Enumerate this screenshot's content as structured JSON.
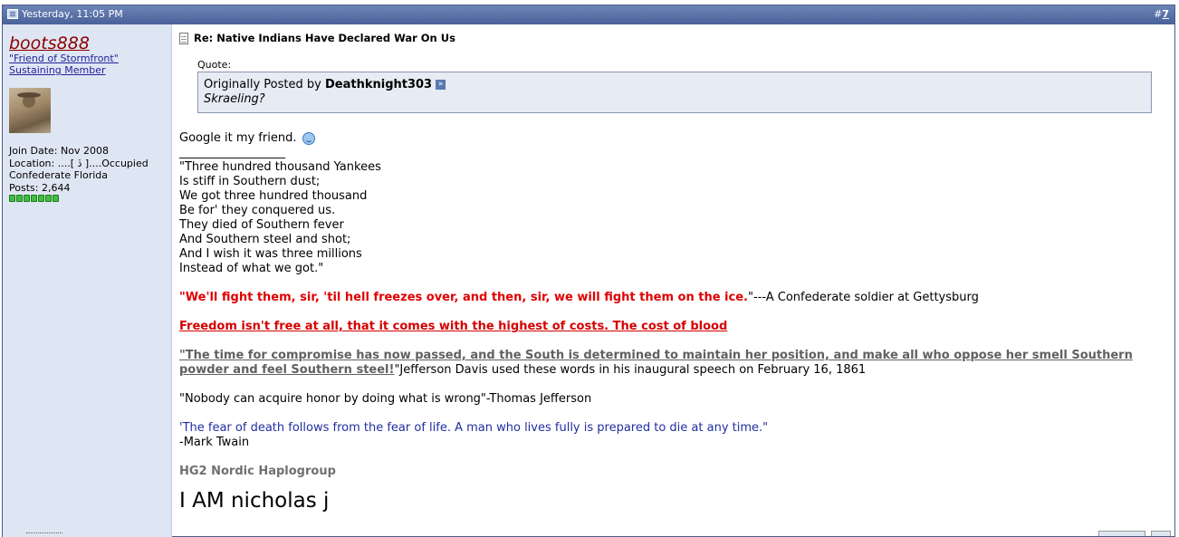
{
  "header": {
    "timestamp": "Yesterday, 11:05 PM",
    "post_link_prefix": "#",
    "post_number": "7"
  },
  "user": {
    "name": "boots888",
    "title_line1": "\"Friend of Stormfront\"",
    "title_line2": "Sustaining Member",
    "join_date": "Join Date: Nov 2008",
    "location_line1": "Location: ....[ ڏ ]....Occupied",
    "location_line2": "Confederate Florida",
    "posts": "Posts: 2,644",
    "rep_count": 7
  },
  "post": {
    "title": "Re: Native Indians Have Declared War On Us",
    "quote_label": "Quote:",
    "quote_prefix": "Originally Posted by",
    "quote_author": "Deathknight303",
    "quote_text": "Skraeling?",
    "reply_text": "Google it my friend.",
    "sig_divider": "__________________",
    "poem": [
      "\"Three hundred thousand Yankees",
      "Is stiff in Southern dust;",
      "We got three hundred thousand",
      "Be for' they conquered us.",
      "They died of Southern fever",
      "And Southern steel and shot;",
      "And I wish it was three millions",
      "Instead of what we got.\""
    ],
    "quote1_open": "\"",
    "quote1_bold": "We'll fight them, sir, 'til hell freezes over, and then, sir, we will fight them on the ice.",
    "quote1_rest": "\"---A Confederate soldier at Gettysburg",
    "quote2": "Freedom isn't free at all, that it comes with the highest of costs. The cost of blood",
    "quote3_bold": "\"The time for compromise has now passed, and the South is determined to maintain her position, and make all who oppose her smell Southern powder and feel Southern steel!",
    "quote3_rest": "\"Jefferson Davis used these words in his inaugural speech on February 16, 1861",
    "quote4": "\"Nobody can acquire honor by doing what is wrong\"-Thomas Jefferson",
    "quote5": "'The fear of death follows from the fear of life. A man who lives fully is prepared to die at any time.\"",
    "quote5_author": "-Mark Twain",
    "haplogroup": "HG2 Nordic Haplogroup",
    "big_text": "I AM nicholas j"
  },
  "colors": {
    "header_bg": "#4a6199",
    "sidebar_bg": "#dfe6f3",
    "username": "#8b0000",
    "red_quote": "#e00000",
    "blue_quote": "#1f2f9f"
  }
}
